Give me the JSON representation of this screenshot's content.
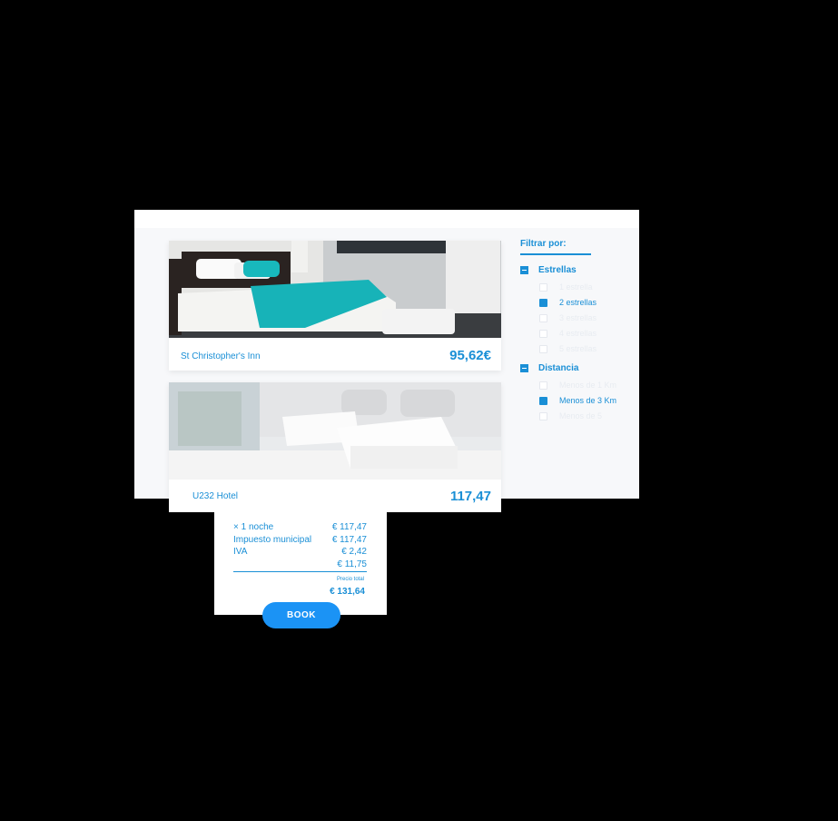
{
  "hotels": [
    {
      "name": "St Christopher's Inn",
      "price": "95,62€"
    },
    {
      "name": "U232 Hotel",
      "price": "117,47"
    }
  ],
  "filters": {
    "title": "Filtrar por:",
    "groups": [
      {
        "label": "Estrellas",
        "options": [
          {
            "label": "1 estrella",
            "checked": false
          },
          {
            "label": "2 estrellas",
            "checked": true
          },
          {
            "label": "3 estrellas",
            "checked": false
          },
          {
            "label": "4 estrellas",
            "checked": false
          },
          {
            "label": "5 estrellas",
            "checked": false
          }
        ]
      },
      {
        "label": "Distancia",
        "options": [
          {
            "label": "Menos de 1 Km",
            "checked": false
          },
          {
            "label": "Menos de 3 Km",
            "checked": true
          },
          {
            "label": "Menos de 5",
            "checked": false
          }
        ]
      }
    ]
  },
  "receipt": {
    "rows": [
      {
        "label": "× 1 noche",
        "value": "€ 117,47"
      },
      {
        "label": "Impuesto municipal",
        "value": "€ 117,47"
      },
      {
        "label": "IVA",
        "value": "€ 2,42"
      },
      {
        "label": "",
        "value": "€ 11,75"
      }
    ],
    "total_label": "Precio total",
    "total_value": "€ 131,64"
  },
  "book_label": "BOOK",
  "colors": {
    "accent": "#1a8fd6",
    "button": "#1b93f5",
    "teal": "#17b3b8"
  }
}
